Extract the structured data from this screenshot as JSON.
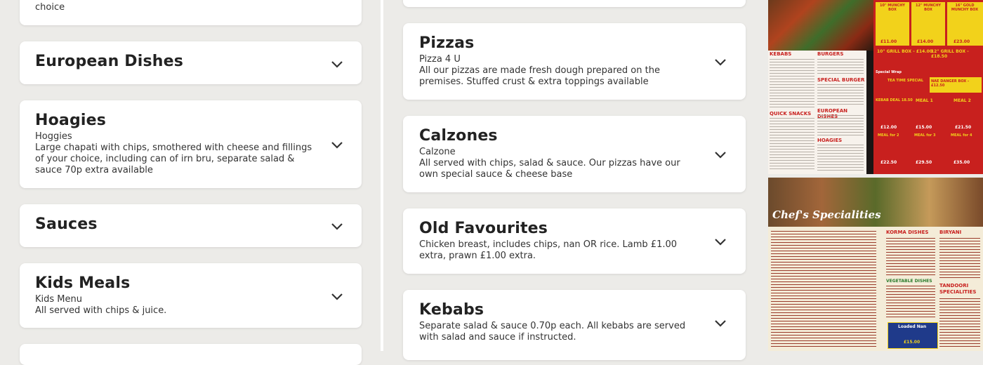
{
  "left_column": {
    "top_partial_desc": "choice",
    "cards": [
      {
        "title": "European Dishes"
      },
      {
        "title": "Hoagies",
        "subtitle": "Hoggies",
        "description": "Large chapati with chips, smothered with cheese and fillings of your choice, including can of irn bru, separate salad & sauce 70p extra available"
      },
      {
        "title": "Sauces"
      },
      {
        "title": "Kids Meals",
        "subtitle": "Kids Menu",
        "description": "All served with chips & juice."
      }
    ]
  },
  "middle_column": {
    "cards": [
      {
        "title": "Pizzas",
        "subtitle": "Pizza 4 U",
        "description": "All our pizzas are made fresh dough prepared on the premises. Stuffed crust & extra toppings available"
      },
      {
        "title": "Calzones",
        "subtitle": "Calzone",
        "description": "All served with chips, salad & sauce. Our pizzas have our own special sauce & cheese base"
      },
      {
        "title": "Old Favourites",
        "description": "Chicken breast, includes chips, nan OR rice. Lamb £1.00 extra, prawn £1.00 extra."
      },
      {
        "title": "Kebabs",
        "description": "Separate salad & sauce 0.70p each. All kebabs are served with salad and sauce if instructed."
      }
    ]
  },
  "menu_images": {
    "top": {
      "headings": [
        "KEBABS",
        "BURGERS",
        "SPECIAL BURGER",
        "EUROPEAN DISHES",
        "HOAGIES",
        "QUICK SNACKS"
      ],
      "boxes": [
        "10\" MUNCHY BOX",
        "12\" MUNCHY BOX",
        "16\" GOLD MUNCHY BOX",
        "12\" MUNCHY BOX",
        "10\" GRILL BOX - £14.00",
        "12\" GRILL BOX - £18.50",
        "TEA TIME SPECIAL",
        "Special Wrap",
        "NAE DANGER BOX - £12.50",
        "KEBAB DEAL 18.50",
        "MEAL 1",
        "MEAL 2",
        "MEAL 3",
        "MEAL for 2",
        "MEAL for 3",
        "MEAL for 4"
      ],
      "prices": [
        "£11.00",
        "£14.00",
        "£23.00",
        "£12.00",
        "£15.00",
        "£21.50",
        "£22.50",
        "£29.50",
        "£35.00"
      ]
    },
    "bottom": {
      "headings": [
        "Chef's Specialities",
        "KORMA DISHES",
        "BIRYANI",
        "VEGETABLE DISHES",
        "TANDOORI SPECIALITIES"
      ],
      "boxes": [
        "Loaded Nan",
        "£15.00"
      ]
    }
  },
  "colors": {
    "page_bg": "#ecebe8",
    "card_bg": "#ffffff",
    "menu_red": "#c8201e",
    "menu_yellow": "#f2d21b",
    "menu_cream": "#f4ecd8"
  }
}
